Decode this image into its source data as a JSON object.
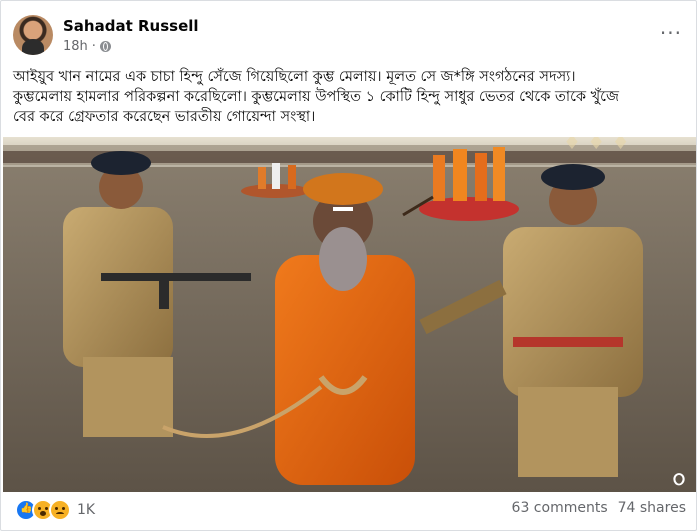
{
  "post": {
    "author": "Sahadat Russell",
    "time": "18h",
    "visibility_icon": "globe-icon",
    "menu_icon": "more-options-icon",
    "menu_glyph": "···",
    "text_lines": [
      "আইয়ুব খান নামের এক চাচা হিন্দু সেঁজে গিয়েছিলো কুম্ভ মেলায়। মূলত সে জ*ঙ্গি সংগঠনের সদস্য।",
      "কুম্ভমেলায় হামলার পরিকল্পনা করেছিলো। কুম্ভমেলায় উপস্থিত ১ কোটি হিন্দু সাধুর ভেতর থেকে তাকে খুঁজে",
      "বের করে গ্রেফতার করেছেন ভারতীয় গোয়েন্দা সংস্থা।"
    ]
  },
  "photo": {
    "corner_label": "ଠ"
  },
  "footer": {
    "reactions": [
      "like",
      "wow",
      "sad"
    ],
    "reaction_count": "1K",
    "comments": "63 comments",
    "shares": "74 shares"
  },
  "colors": {
    "link": "#050505",
    "meta": "#65676b",
    "like_blue": "#1877f2",
    "emoji_yellow": "#f7b125"
  }
}
